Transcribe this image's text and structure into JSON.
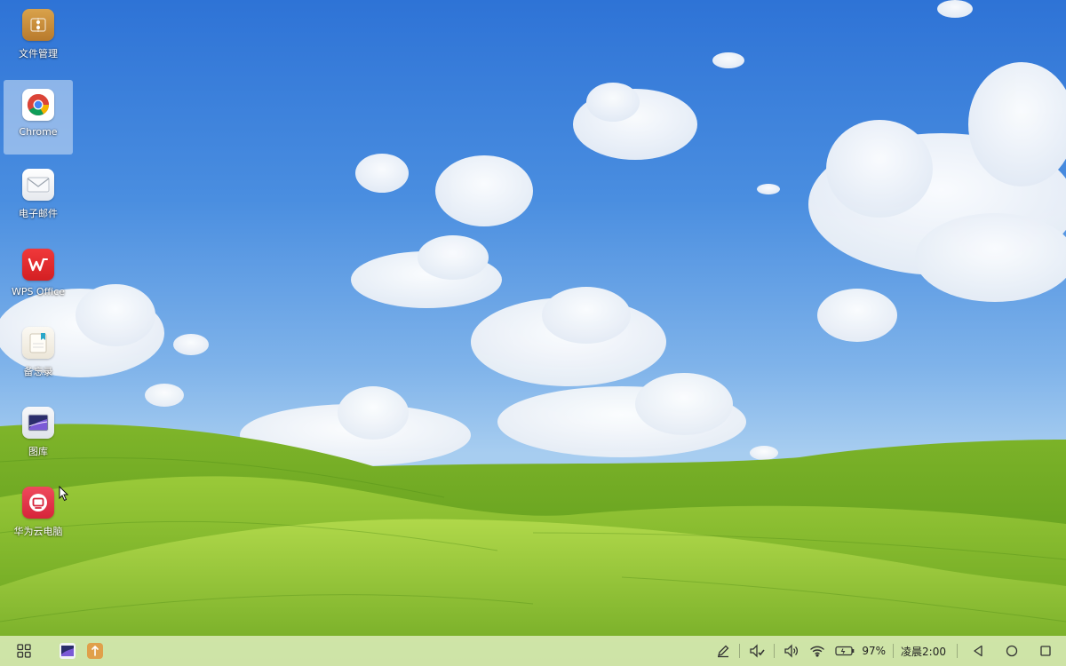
{
  "desktop": {
    "icons": [
      {
        "label": "文件管理",
        "icon": "file-manager-icon",
        "color": "#c8913e"
      },
      {
        "label": "Chrome",
        "icon": "chrome-icon",
        "selected": true
      },
      {
        "label": "电子邮件",
        "icon": "email-icon",
        "color": "#f4f6f8"
      },
      {
        "label": "WPS Office",
        "icon": "wps-office-icon",
        "color": "#e02a2a"
      },
      {
        "label": "备忘录",
        "icon": "memo-icon",
        "color": "#f6f3ec"
      },
      {
        "label": "图库",
        "icon": "gallery-icon",
        "color": "#eef0f4"
      },
      {
        "label": "华为云电脑",
        "icon": "huawei-cloud-pc-icon",
        "color": "#e8344a"
      }
    ]
  },
  "taskbar": {
    "start_icon": "app-grid-icon",
    "pinned": [
      "gallery-icon",
      "file-manager-icon"
    ],
    "tray": {
      "pen_icon": "stylus-icon",
      "notify_icon": "do-not-disturb-icon",
      "volume_icon": "volume-icon",
      "wifi_icon": "wifi-icon",
      "battery_icon": "battery-icon",
      "battery_percent": "97%",
      "clock": "凌晨2:00"
    },
    "nav": [
      "back-icon",
      "home-icon",
      "recents-icon"
    ]
  }
}
